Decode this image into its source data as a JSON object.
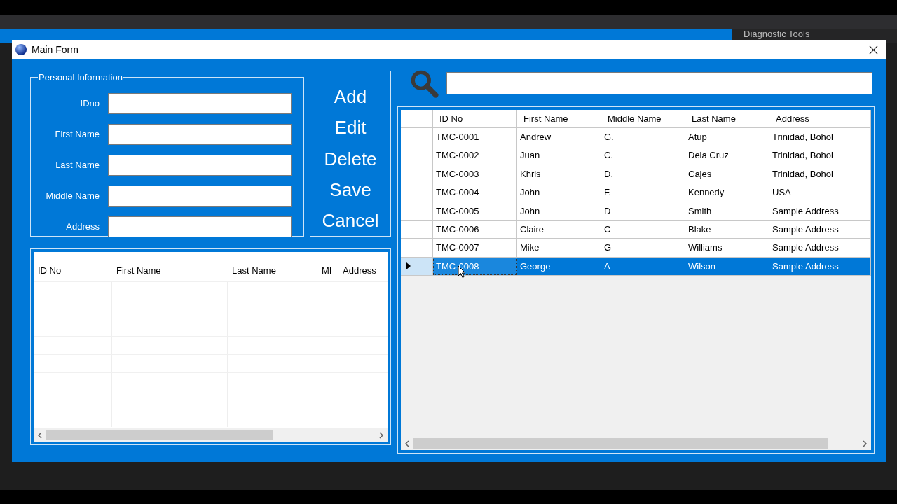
{
  "background": {
    "panel_title": "Diagnostic Tools"
  },
  "window": {
    "title": "Main Form"
  },
  "personal_info": {
    "title": "Personal Information",
    "fields": [
      {
        "label": "IDno"
      },
      {
        "label": "First Name"
      },
      {
        "label": "Last Name"
      },
      {
        "label": "Middle Name"
      },
      {
        "label": "Address"
      }
    ]
  },
  "buttons": [
    "Add",
    "Edit",
    "Delete",
    "Save",
    "Cancel"
  ],
  "entry_table": {
    "columns": [
      "ID No",
      "First Name",
      "Last Name",
      "MI",
      "Address"
    ]
  },
  "records_table": {
    "columns": [
      "ID No",
      "First Name",
      "Middle Name",
      "Last Name",
      "Address"
    ],
    "rows": [
      {
        "cells": [
          "TMC-0001",
          "Andrew",
          "G.",
          "Atup",
          "Trinidad, Bohol"
        ],
        "selected": false
      },
      {
        "cells": [
          "TMC-0002",
          "Juan",
          "C.",
          "Dela Cruz",
          "Trinidad, Bohol"
        ],
        "selected": false
      },
      {
        "cells": [
          "TMC-0003",
          "Khris",
          "D.",
          "Cajes",
          "Trinidad, Bohol"
        ],
        "selected": false
      },
      {
        "cells": [
          "TMC-0004",
          "John",
          "F.",
          "Kennedy",
          "USA"
        ],
        "selected": false
      },
      {
        "cells": [
          "TMC-0005",
          "John",
          "D",
          "Smith",
          "Sample Address"
        ],
        "selected": false
      },
      {
        "cells": [
          "TMC-0006",
          "Claire",
          "C",
          "Blake",
          "Sample Address"
        ],
        "selected": false
      },
      {
        "cells": [
          "TMC-0007",
          "Mike",
          "G",
          "Williams",
          "Sample Address"
        ],
        "selected": false
      },
      {
        "cells": [
          "TMC-0008",
          "George",
          "A",
          "Wilson",
          "Sample Address"
        ],
        "selected": true
      }
    ]
  }
}
